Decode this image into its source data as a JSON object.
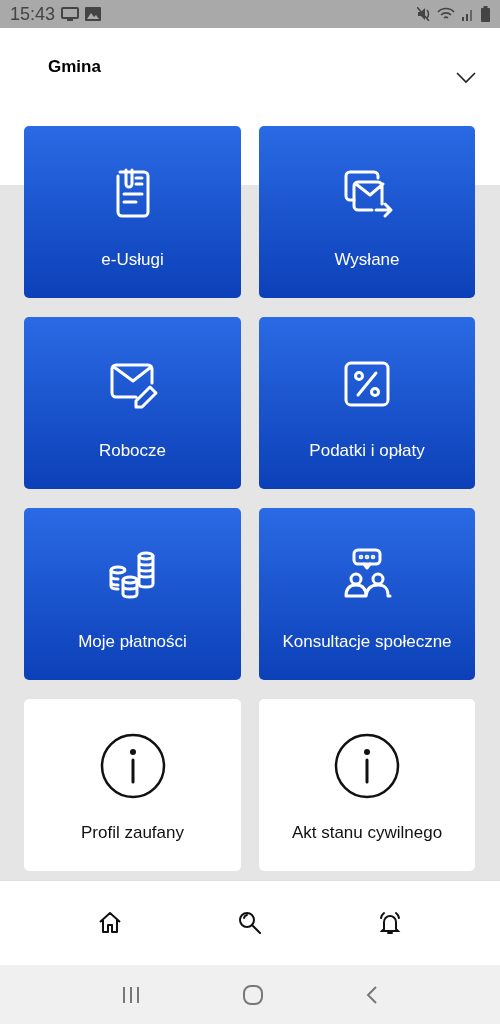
{
  "status_bar": {
    "time": "15:43"
  },
  "header": {
    "title": "Gmina",
    "expanded": false
  },
  "tiles": [
    {
      "label": "e-Usługi",
      "kind": "blue"
    },
    {
      "label": "Wysłane",
      "kind": "blue"
    },
    {
      "label": "Robocze",
      "kind": "blue"
    },
    {
      "label": "Podatki i opłaty",
      "kind": "blue"
    },
    {
      "label": "Moje płatności",
      "kind": "blue"
    },
    {
      "label": "Konsultacje społeczne",
      "kind": "blue"
    },
    {
      "label": "Profil zaufany",
      "kind": "white"
    },
    {
      "label": "Akt stanu cywilnego",
      "kind": "white"
    }
  ]
}
